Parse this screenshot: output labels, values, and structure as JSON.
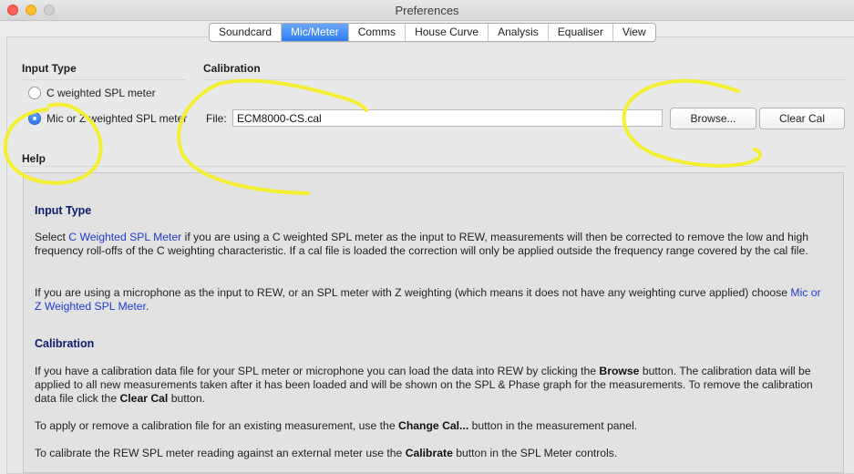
{
  "window": {
    "title": "Preferences"
  },
  "tabs": [
    {
      "label": "Soundcard"
    },
    {
      "label": "Mic/Meter",
      "active": true
    },
    {
      "label": "Comms"
    },
    {
      "label": "House Curve"
    },
    {
      "label": "Analysis"
    },
    {
      "label": "Equaliser"
    },
    {
      "label": "View"
    }
  ],
  "input_type": {
    "heading": "Input Type",
    "options": [
      {
        "label": "C weighted SPL meter",
        "selected": false
      },
      {
        "label": "Mic or Z weighted SPL meter",
        "selected": true
      }
    ]
  },
  "calibration": {
    "heading": "Calibration",
    "file_label": "File:",
    "file_value": "ECM8000-CS.cal",
    "browse_label": "Browse...",
    "clear_label": "Clear Cal"
  },
  "help": {
    "heading": "Help",
    "input_type_title": "Input Type",
    "p1_a": "Select ",
    "p1_link": "C Weighted SPL Meter",
    "p1_b": " if you are using a C weighted SPL meter as the input to REW, measurements will then be corrected to remove the low and high frequency roll-offs of the C weighting characteristic. If a cal file is loaded the correction will only be applied outside the frequency range covered by the cal file.",
    "p2_a": "If you are using a microphone as the input to REW, or an SPL meter with Z weighting (which means it does not have any weighting curve applied) choose ",
    "p2_link": "Mic or Z Weighted SPL Meter",
    "p2_b": ".",
    "calibration_title": "Calibration",
    "p3_a": "If you have a calibration data file for your SPL meter or microphone you can load the data into REW by clicking the ",
    "p3_b1": "Browse",
    "p3_c": " button. The calibration data will be applied to all new measurements taken after it has been loaded and will be shown on the SPL & Phase graph for the measurements. To remove the calibration data file click the ",
    "p3_b2": "Clear Cal",
    "p3_d": " button.",
    "p4_a": "To apply or remove a calibration file for an existing measurement, use the ",
    "p4_b": "Change Cal...",
    "p4_c": " button in the measurement panel.",
    "p5_a": "To calibrate the REW SPL meter reading against an external meter use the ",
    "p5_b": "Calibrate",
    "p5_c": " button in the SPL Meter controls."
  },
  "colors": {
    "active_tab": "#2f7cf2",
    "link": "#1f3ccf",
    "help_heading": "#0b1b6e",
    "annotation": "#f5ef2a"
  }
}
